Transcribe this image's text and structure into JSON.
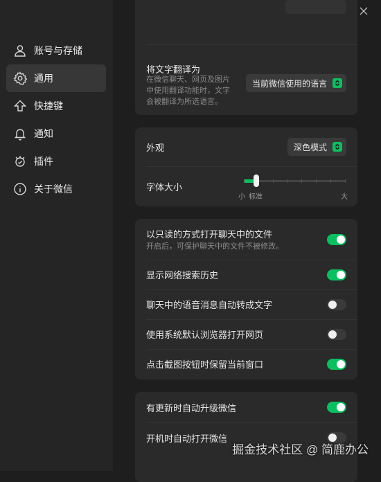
{
  "sidebar": {
    "items": [
      {
        "label": "账号与存储",
        "icon": "user-icon",
        "active": false
      },
      {
        "label": "通用",
        "icon": "gear-icon",
        "active": true
      },
      {
        "label": "快捷键",
        "icon": "arrow-up-icon",
        "active": false
      },
      {
        "label": "通知",
        "icon": "bell-icon",
        "active": false
      },
      {
        "label": "插件",
        "icon": "plugin-icon",
        "active": false
      },
      {
        "label": "关于微信",
        "icon": "info-icon",
        "active": false
      }
    ]
  },
  "general": {
    "translate": {
      "title": "将文字翻译为",
      "description_line1": "在微信聊天、网页及图片",
      "description_line2": "中使用翻译功能时，文字",
      "description_line3": "会被翻译为所选语言。",
      "value": "当前微信使用的语言"
    },
    "appearance": {
      "label": "外观",
      "value": "深色模式"
    },
    "font_size": {
      "label": "字体大小",
      "min_label": "小",
      "default_label": "标准",
      "max_label": "大",
      "level": 1,
      "levels": 8
    },
    "toggles": [
      {
        "label": "以只读的方式打开聊天中的文件",
        "sub": "开启后，可保护聊天中的文件不被修改。",
        "on": true
      },
      {
        "label": "显示网络搜索历史",
        "on": true
      },
      {
        "label": "聊天中的语音消息自动转成文字",
        "on": false
      },
      {
        "label": "使用系统默认浏览器打开网页",
        "on": false
      },
      {
        "label": "点击截图按钮时保留当前窗口",
        "on": true
      }
    ],
    "updates": [
      {
        "label": "有更新时自动升级微信",
        "on": true
      },
      {
        "label": "开机时自动打开微信",
        "on": false
      }
    ]
  },
  "colors": {
    "accent": "#07c160",
    "background": "#1e1e1e",
    "sidebar": "#252525",
    "card": "#2a2a2a"
  },
  "watermark": "掘金技术社区 @ 简鹿办公"
}
